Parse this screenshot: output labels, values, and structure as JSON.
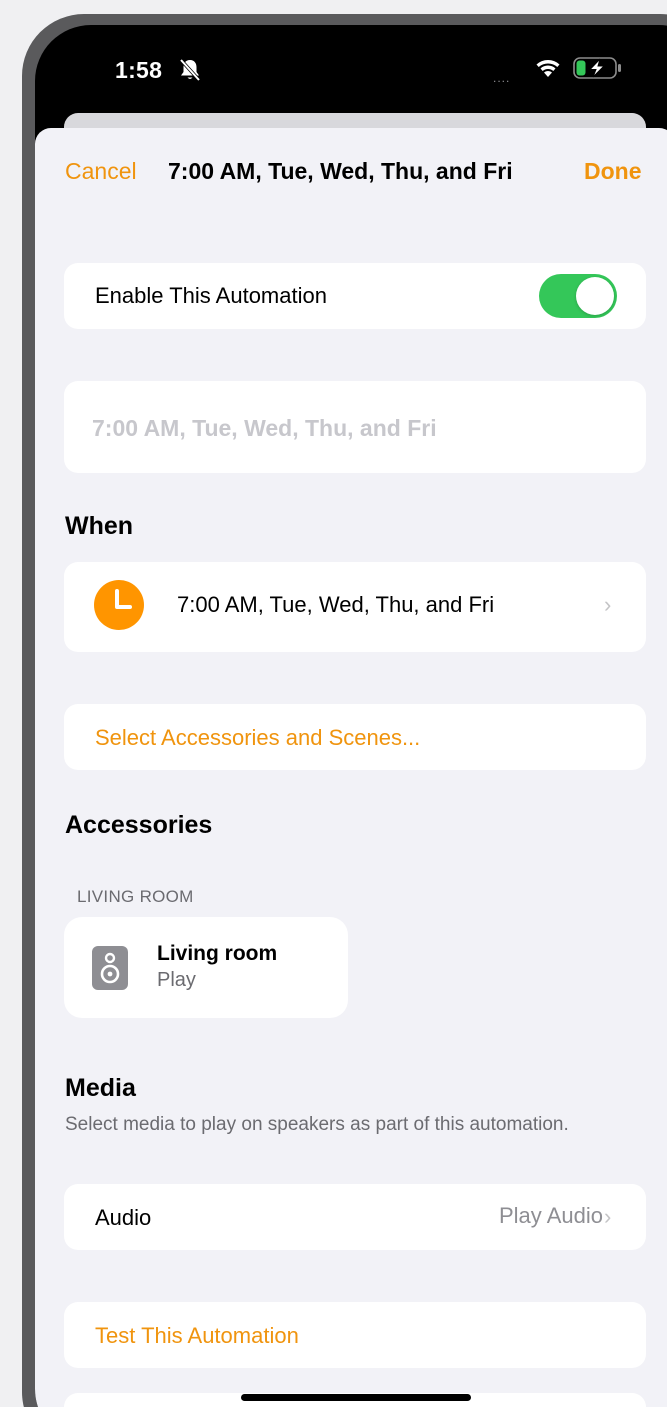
{
  "status_bar": {
    "time": "1:58",
    "signal": "....",
    "bell_icon": "bell-slash-icon",
    "wifi_icon": "wifi-icon",
    "battery_icon": "battery-charging-icon"
  },
  "nav": {
    "cancel_label": "Cancel",
    "title": "7:00 AM, Tue, Wed, Thu, and Fri",
    "done_label": "Done"
  },
  "enable_row": {
    "label": "Enable This Automation",
    "toggle_on": true
  },
  "name_field": {
    "placeholder": "7:00 AM, Tue, Wed, Thu, and Fri"
  },
  "when_section": {
    "title": "When",
    "trigger_text": "7:00 AM, Tue, Wed, Thu, and Fri",
    "icon": "clock-icon",
    "chevron": "›"
  },
  "select_accessories": {
    "label": "Select Accessories and Scenes..."
  },
  "accessories_section": {
    "title": "Accessories",
    "group_label": "LIVING ROOM",
    "tile": {
      "icon": "speaker-icon",
      "name": "Living room",
      "status": "Play"
    }
  },
  "media_section": {
    "title": "Media",
    "description": "Select media to play on speakers as part of this automation.",
    "audio_label": "Audio",
    "audio_value": "Play Audio",
    "chevron": "›"
  },
  "test_automation": {
    "label": "Test This Automation"
  },
  "colors": {
    "accent": "#f0940e",
    "toggle_on": "#34c759",
    "background": "#f2f2f7"
  }
}
